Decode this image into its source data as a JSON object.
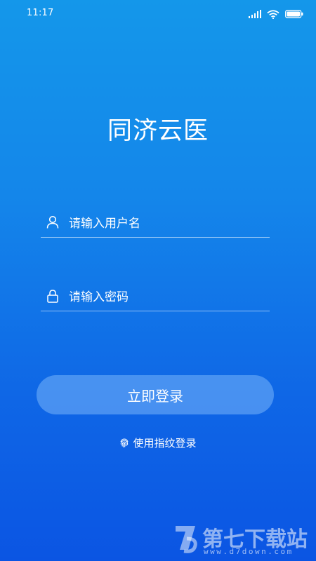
{
  "status_bar": {
    "time": "11:17"
  },
  "app": {
    "title": "同济云医"
  },
  "login_form": {
    "username_placeholder": "请输入用户名",
    "password_placeholder": "请输入密码",
    "login_button_label": "立即登录",
    "fingerprint_link_label": "使用指纹登录"
  },
  "watermark": {
    "name": "第七下载站",
    "url": "www.d7down.com"
  },
  "icons": {
    "username": "user-icon",
    "password": "lock-icon",
    "fingerprint": "fingerprint-icon",
    "signal": "signal-icon",
    "wifi": "wifi-icon",
    "battery": "battery-icon"
  },
  "colors": {
    "background_top": "#1497ea",
    "background_bottom": "#0b55e3",
    "button_fill": "#78b4fa"
  }
}
